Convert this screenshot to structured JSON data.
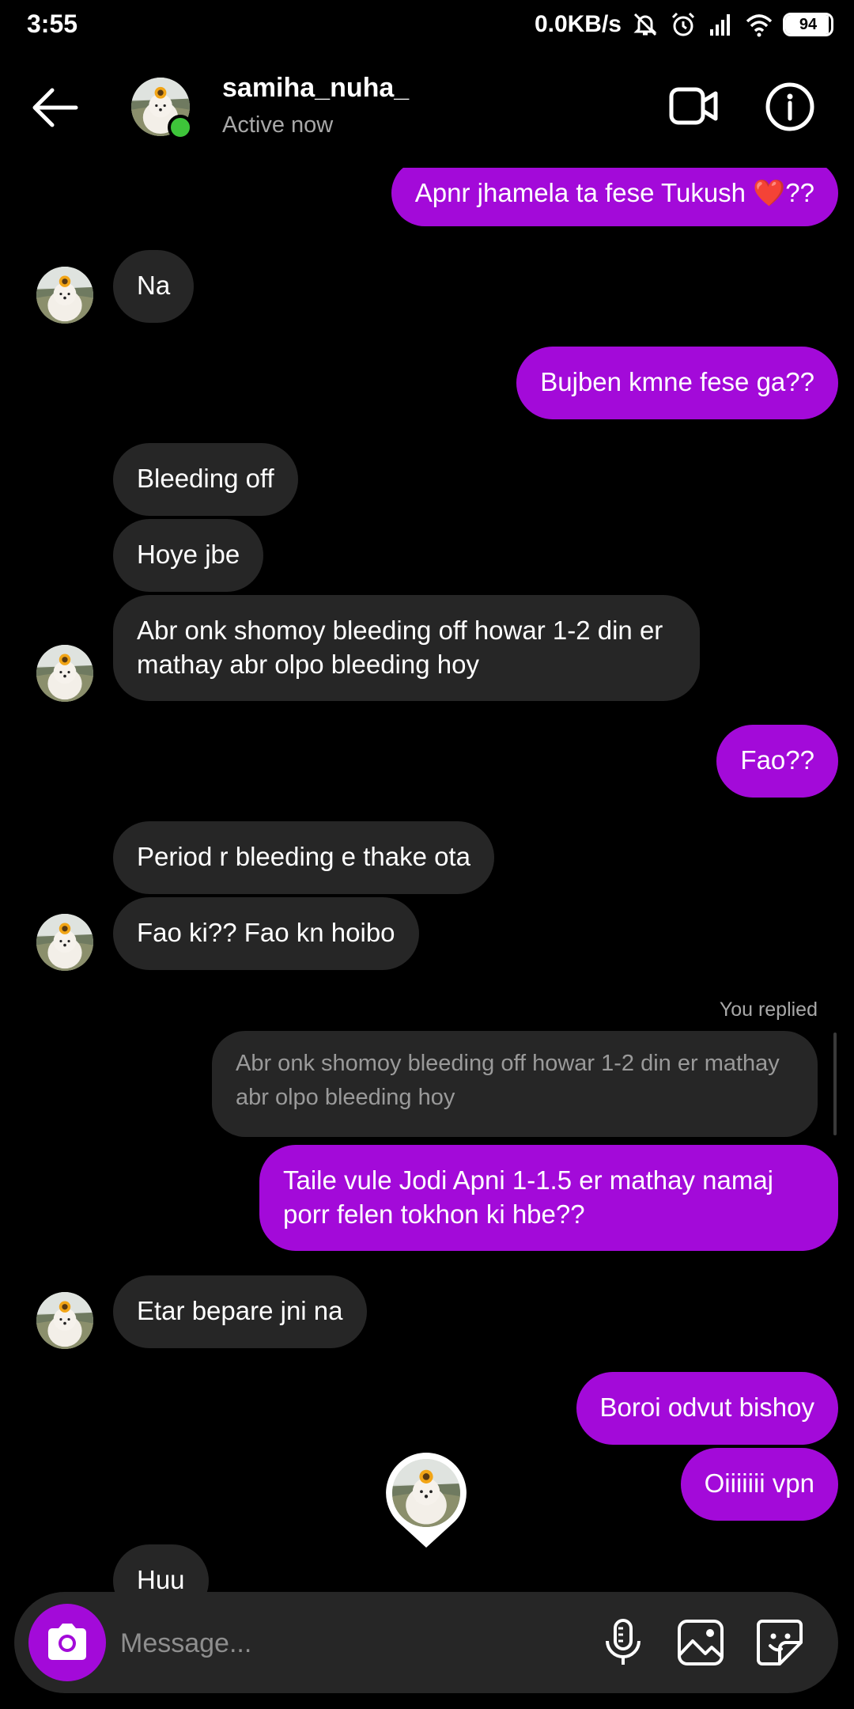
{
  "status_bar": {
    "time": "3:55",
    "net_speed": "0.0KB/s",
    "battery": "94",
    "battery_level": 0.94,
    "icons": [
      "mute-icon",
      "alarm-icon",
      "signal-icon",
      "wifi-icon",
      "battery-icon"
    ]
  },
  "header": {
    "username": "samiha_nuha_",
    "status": "Active now",
    "icons": [
      "back-arrow-icon",
      "video-call-icon",
      "info-icon"
    ],
    "online_color": "#3ec53a"
  },
  "messages": [
    {
      "from": "me",
      "text": "Apnr jhamela ta fese Tukush ❤️??"
    },
    {
      "from": "them",
      "text": "Na"
    },
    {
      "from": "me",
      "text": "Bujben kmne fese ga??"
    },
    {
      "from": "them",
      "text": "Bleeding off"
    },
    {
      "from": "them",
      "text": "Hoye jbe"
    },
    {
      "from": "them",
      "text": "Abr onk shomoy bleeding off howar 1-2 din er mathay abr olpo bleeding hoy"
    },
    {
      "from": "me",
      "text": "Fao??"
    },
    {
      "from": "them",
      "text": "Period r bleeding e thake ota"
    },
    {
      "from": "them",
      "text": "Fao ki?? Fao kn hoibo"
    },
    {
      "from": "me",
      "text": "Taile vule Jodi Apni 1-1.5 er mathay namaj porr felen tokhon ki hbe??"
    },
    {
      "from": "them",
      "text": "Etar bepare jni na"
    },
    {
      "from": "me",
      "text": "Boroi odvut bishoy"
    },
    {
      "from": "me",
      "text": "Oiiiiiii vpn"
    },
    {
      "from": "them",
      "text": "Huu"
    }
  ],
  "reply": {
    "label": "You replied",
    "quote": "Abr onk shomoy bleeding off howar 1-2 din er mathay abr olpo bleeding hoy"
  },
  "composer": {
    "placeholder": "Message...",
    "icons": [
      "camera-icon",
      "microphone-icon",
      "gallery-icon",
      "sticker-icon"
    ]
  },
  "colors": {
    "background": "#000000",
    "outgoing_bubble": "#a30ad9",
    "incoming_bubble": "#262626",
    "secondary_text": "#a8a8a8"
  }
}
